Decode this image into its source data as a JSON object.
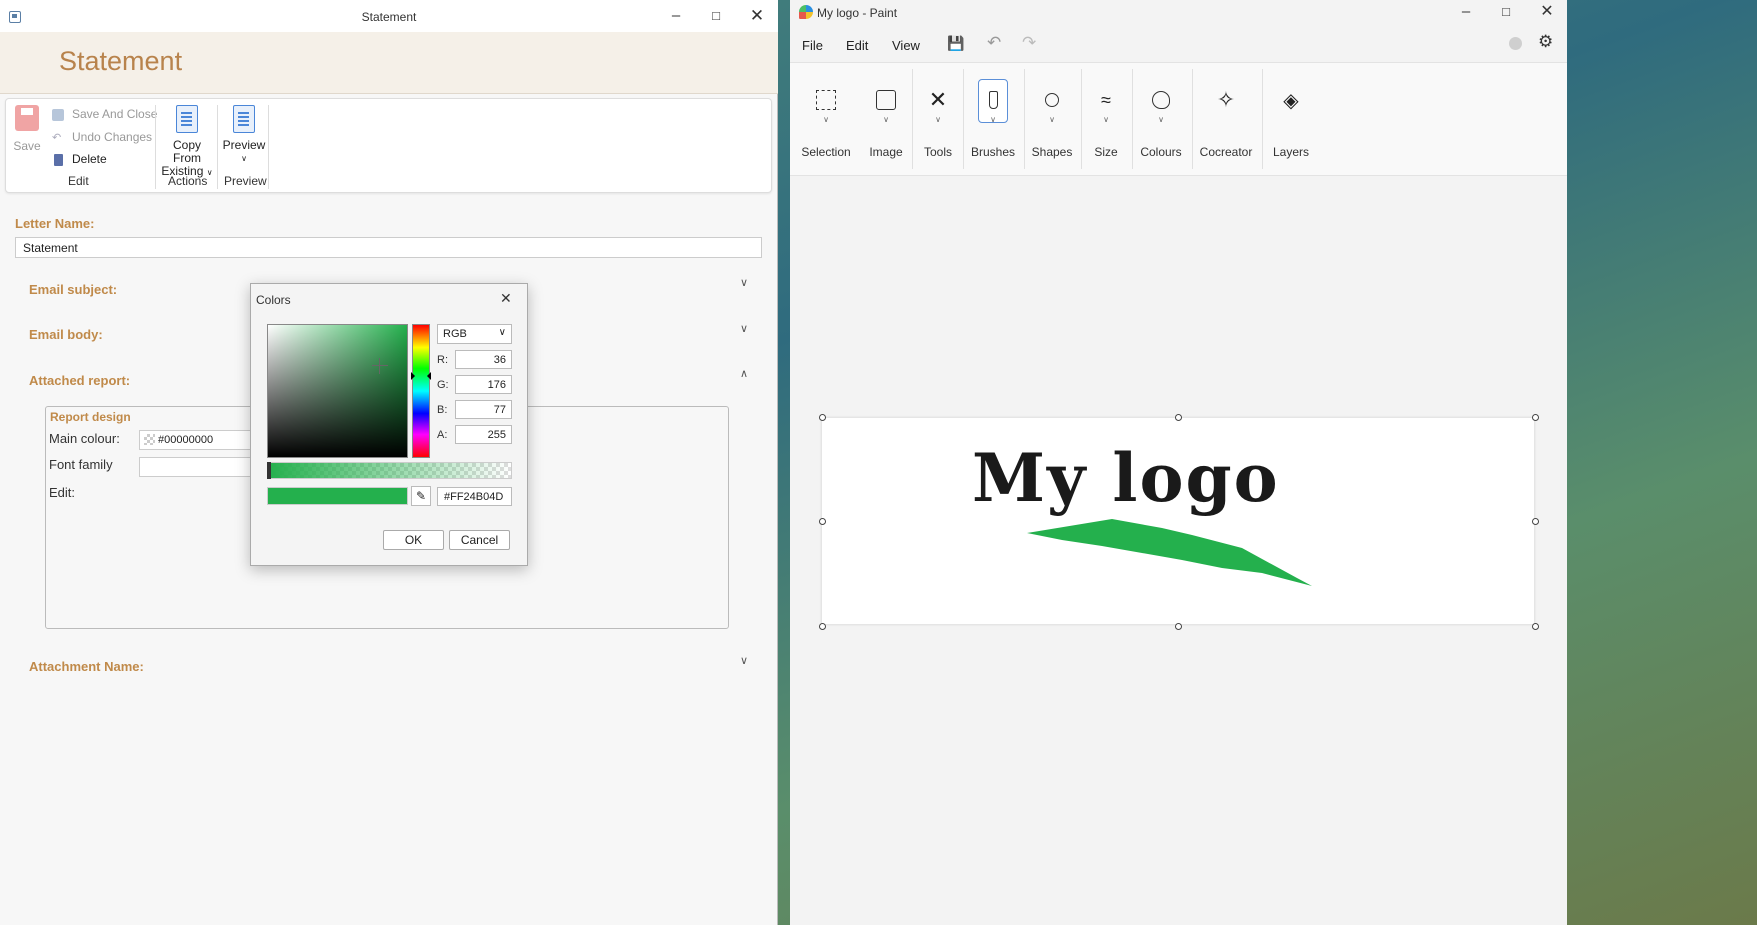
{
  "statement_window": {
    "title": "Statement",
    "header_title": "Statement",
    "ribbon": {
      "save": "Save",
      "save_and_close": "Save And Close",
      "undo_changes": "Undo Changes",
      "delete": "Delete",
      "group_edit": "Edit",
      "copy_from_existing_1": "Copy From",
      "copy_from_existing_2": "Existing",
      "group_actions": "Actions",
      "preview": "Preview",
      "group_preview": "Preview"
    },
    "letter_name_label": "Letter Name:",
    "letter_name_value": "Statement",
    "email_subject_label": "Email subject:",
    "email_body_label": "Email body:",
    "attached_report_label": "Attached report:",
    "report_design": {
      "title": "Report design",
      "main_colour_label": "Main colour:",
      "main_colour_value": "#00000000",
      "font_family_label": "Font family",
      "edit_label": "Edit:"
    },
    "attachment_name_label": "Attachment Name:"
  },
  "colors_dialog": {
    "title": "Colors",
    "mode": "RGB",
    "r_label": "R:",
    "r": "36",
    "g_label": "G:",
    "g": "176",
    "b_label": "B:",
    "b": "77",
    "a_label": "A:",
    "a": "255",
    "hex": "#FF24B04D",
    "ok": "OK",
    "cancel": "Cancel",
    "selected_color": "#24B04D"
  },
  "paint_window": {
    "title": "My logo - Paint",
    "menu": {
      "file": "File",
      "edit": "Edit",
      "view": "View"
    },
    "tools": {
      "selection": "Selection",
      "image": "Image",
      "tools": "Tools",
      "brushes": "Brushes",
      "shapes": "Shapes",
      "size": "Size",
      "colours": "Colours",
      "cocreator": "Cocreator",
      "layers": "Layers"
    },
    "canvas_text": "My logo",
    "accent": "#5b8fd8",
    "brush_color": "#24B04D"
  }
}
